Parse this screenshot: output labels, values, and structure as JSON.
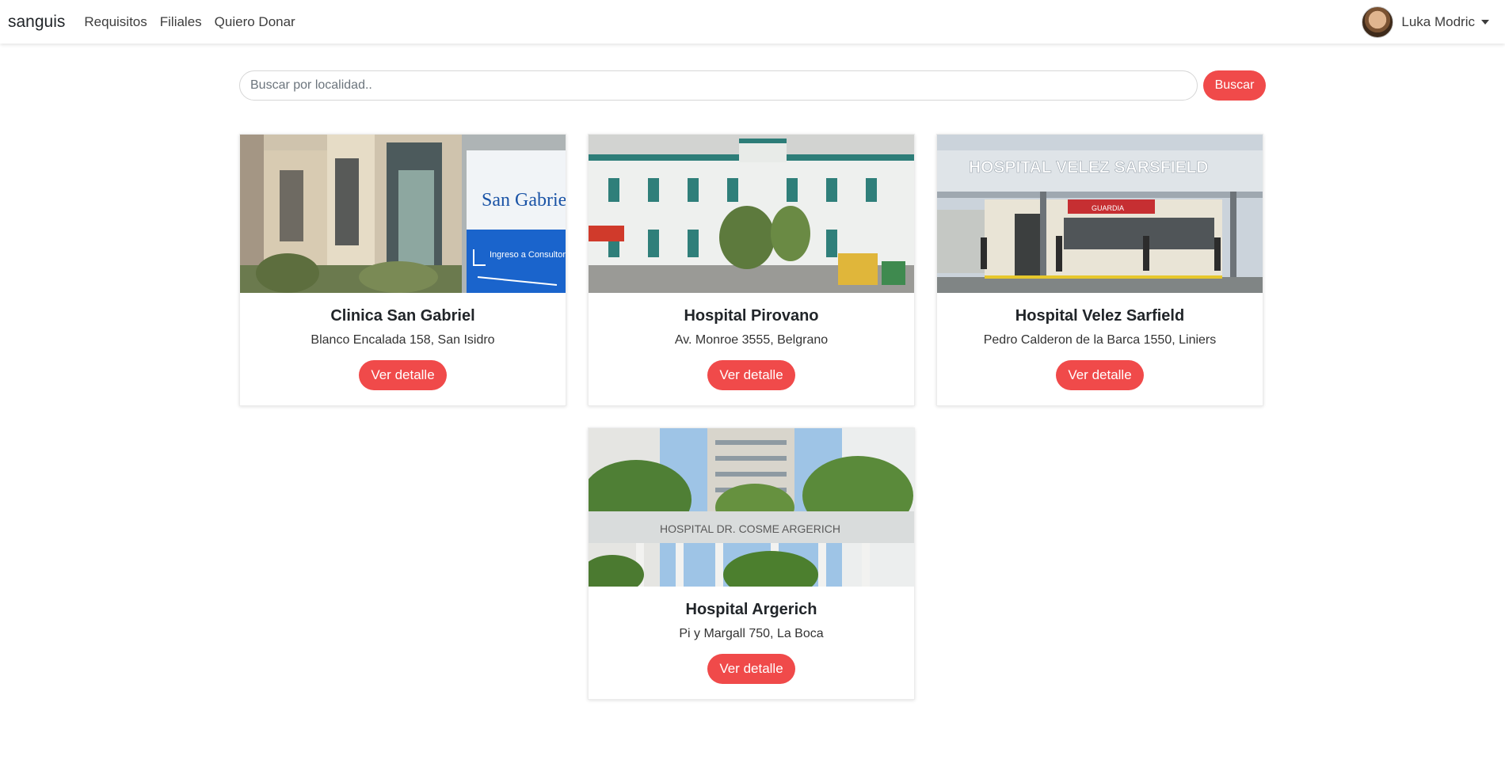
{
  "navbar": {
    "brand": "sanguis",
    "links": [
      "Requisitos",
      "Filiales",
      "Quiero Donar"
    ],
    "user_name": "Luka Modric"
  },
  "search": {
    "placeholder": "Buscar por localidad..",
    "button_label": "Buscar"
  },
  "cards": [
    {
      "title": "Clinica San Gabriel",
      "address": "Blanco Encalada 158, San Isidro",
      "button_label": "Ver detalle",
      "sign_name": "San Gabriel",
      "sign_sub": "Ingreso a Consultorios"
    },
    {
      "title": "Hospital Pirovano",
      "address": "Av. Monroe 3555, Belgrano",
      "button_label": "Ver detalle"
    },
    {
      "title": "Hospital Velez Sarfield",
      "address": "Pedro Calderon de la Barca 1550, Liniers",
      "button_label": "Ver detalle",
      "sign_name": "HOSPITAL VELEZ SARSFIELD",
      "sign_sub": "GUARDIA"
    },
    {
      "title": "Hospital Argerich",
      "address": "Pi y Margall 750, La Boca",
      "button_label": "Ver detalle",
      "sign_name": "HOSPITAL DR. COSME ARGERICH"
    }
  ],
  "colors": {
    "accent": "#f04a4a"
  }
}
